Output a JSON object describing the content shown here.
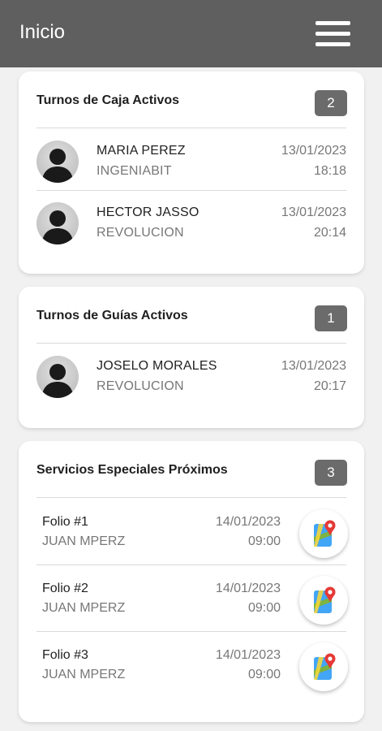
{
  "appbar": {
    "title": "Inicio",
    "menu_icon": "hamburger-menu-icon"
  },
  "caja": {
    "title": "Turnos de Caja Activos",
    "count": "2",
    "items": [
      {
        "name": "MARIA PEREZ",
        "location": "INGENIABIT",
        "date": "13/01/2023",
        "time": "18:18"
      },
      {
        "name": "HECTOR JASSO",
        "location": "REVOLUCION",
        "date": "13/01/2023",
        "time": "20:14"
      }
    ]
  },
  "guias": {
    "title": "Turnos de Guías Activos",
    "count": "1",
    "items": [
      {
        "name": "JOSELO MORALES",
        "location": "REVOLUCION",
        "date": "13/01/2023",
        "time": "20:17"
      }
    ]
  },
  "servicios": {
    "title": "Servicios Especiales Próximos",
    "count": "3",
    "items": [
      {
        "folio": "Folio #1",
        "client": "JUAN MPERZ",
        "date": "14/01/2023",
        "time": "09:00",
        "icon": "map-location-icon"
      },
      {
        "folio": "Folio #2",
        "client": "JUAN MPERZ",
        "date": "14/01/2023",
        "time": "09:00",
        "icon": "map-location-icon"
      },
      {
        "folio": "Folio #3",
        "client": "JUAN MPERZ",
        "date": "14/01/2023",
        "time": "09:00",
        "icon": "map-location-icon"
      }
    ]
  },
  "colors": {
    "appbar": "#5f5f5f",
    "badge": "#6b6b6b",
    "background": "#f1f1f1",
    "map_pin": "#e53935",
    "map_base": "#42a5f5"
  }
}
